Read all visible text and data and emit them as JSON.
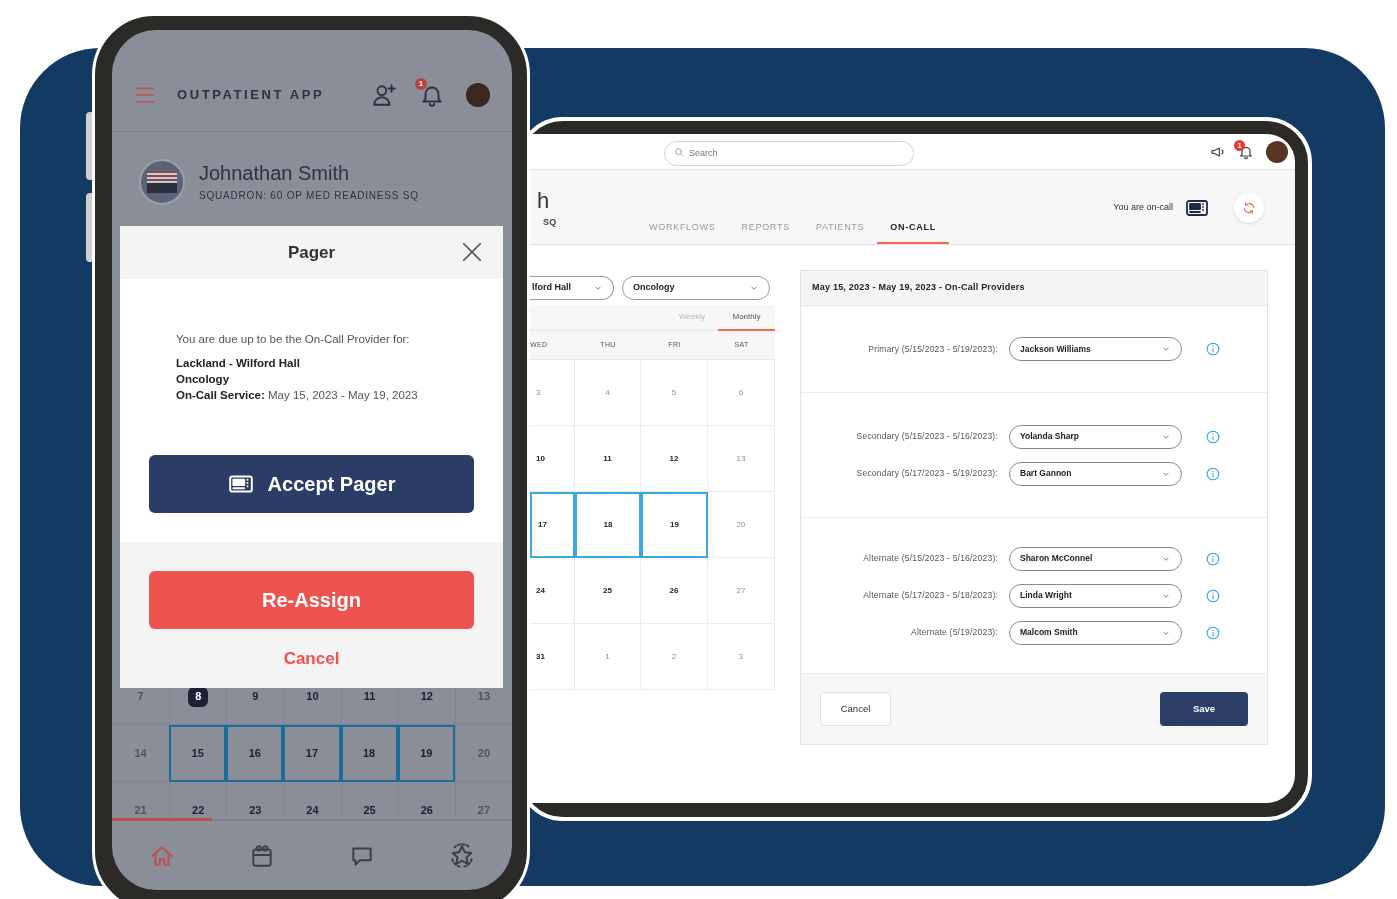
{
  "phone": {
    "app_title": "OUTPATIENT APP",
    "notification_count": "1",
    "user": {
      "name": "Johnathan Smith",
      "squadron": "SQUADRON: 60 OP MED READINESS SQ"
    },
    "modal": {
      "title": "Pager",
      "intro": "You are due up to be the On-Call Provider for:",
      "lines": [
        "**Lackland - Wilford Hall**",
        "**Oncology**",
        "**On-Call Service:** May 15, 2023 - May 19, 2023"
      ],
      "accept_button": "Accept Pager",
      "reassign_button": "Re-Assign",
      "cancel": "Cancel"
    },
    "calendar": [
      [
        {
          "day": "7",
          "muted": true,
          "today": false,
          "selected": false
        },
        {
          "day": "8",
          "muted": false,
          "today": true,
          "selected": false
        },
        {
          "day": "9",
          "muted": false,
          "today": false,
          "selected": false
        },
        {
          "day": "10",
          "muted": false,
          "today": false,
          "selected": false
        },
        {
          "day": "11",
          "muted": false,
          "today": false,
          "selected": false
        },
        {
          "day": "12",
          "muted": false,
          "today": false,
          "selected": false
        },
        {
          "day": "13",
          "muted": true,
          "today": false,
          "selected": false
        }
      ],
      [
        {
          "day": "14",
          "muted": true,
          "today": false,
          "selected": false
        },
        {
          "day": "15",
          "muted": false,
          "today": false,
          "selected": true
        },
        {
          "day": "16",
          "muted": false,
          "today": false,
          "selected": true
        },
        {
          "day": "17",
          "muted": false,
          "today": false,
          "selected": true
        },
        {
          "day": "18",
          "muted": false,
          "today": false,
          "selected": true
        },
        {
          "day": "19",
          "muted": false,
          "today": false,
          "selected": true
        },
        {
          "day": "20",
          "muted": true,
          "today": false,
          "selected": false
        }
      ],
      [
        {
          "day": "21",
          "muted": true,
          "today": false,
          "selected": false
        },
        {
          "day": "22",
          "muted": false,
          "today": false,
          "selected": false
        },
        {
          "day": "23",
          "muted": false,
          "today": false,
          "selected": false
        },
        {
          "day": "24",
          "muted": false,
          "today": false,
          "selected": false
        },
        {
          "day": "25",
          "muted": false,
          "today": false,
          "selected": false
        },
        {
          "day": "26",
          "muted": false,
          "today": false,
          "selected": false
        },
        {
          "day": "27",
          "muted": true,
          "today": false,
          "selected": false
        }
      ]
    ],
    "bottom_nav": [
      {
        "selected": true
      },
      {
        "selected": false
      },
      {
        "selected": false
      },
      {
        "selected": false
      }
    ]
  },
  "tablet": {
    "search": {
      "placeholder": "Search"
    },
    "notification_count": "1",
    "header": {
      "name_fragment": "h",
      "squadron_fragment": "SQ"
    },
    "tabs": [
      {
        "label": "WORKFLOWS",
        "selected": false
      },
      {
        "label": "REPORTS",
        "selected": false
      },
      {
        "label": "PATIENTS",
        "selected": false
      },
      {
        "label": "ON-CALL",
        "selected": true
      }
    ],
    "on_call_status": "You are on-call",
    "calendar": {
      "filters": [
        "lford Hall",
        "Oncology"
      ],
      "views": [
        {
          "label": "Weekly",
          "selected": false
        },
        {
          "label": "Monthly",
          "selected": true
        }
      ],
      "days": [
        "WED",
        "THU",
        "FRI",
        "SAT"
      ],
      "weeks": [
        [
          {
            "day": "3",
            "muted": true,
            "selected": false
          },
          {
            "day": "4",
            "muted": true,
            "selected": false
          },
          {
            "day": "5",
            "muted": true,
            "selected": false
          },
          {
            "day": "6",
            "muted": true,
            "selected": false
          }
        ],
        [
          {
            "day": "10",
            "muted": false,
            "selected": false
          },
          {
            "day": "11",
            "muted": false,
            "selected": false
          },
          {
            "day": "12",
            "muted": false,
            "selected": false
          },
          {
            "day": "13",
            "muted": true,
            "selected": false
          }
        ],
        [
          {
            "day": "17",
            "muted": false,
            "selected": true
          },
          {
            "day": "18",
            "muted": false,
            "selected": true
          },
          {
            "day": "19",
            "muted": false,
            "selected": true
          },
          {
            "day": "20",
            "muted": true,
            "selected": false
          }
        ],
        [
          {
            "day": "24",
            "muted": false,
            "selected": false
          },
          {
            "day": "25",
            "muted": false,
            "selected": false
          },
          {
            "day": "26",
            "muted": false,
            "selected": false
          },
          {
            "day": "27",
            "muted": true,
            "selected": false
          }
        ],
        [
          {
            "day": "31",
            "muted": false,
            "selected": false
          },
          {
            "day": "1",
            "muted": true,
            "selected": false
          },
          {
            "day": "2",
            "muted": true,
            "selected": false
          },
          {
            "day": "3",
            "muted": true,
            "selected": false
          }
        ]
      ]
    },
    "panel": {
      "title": "May 15, 2023 - May 19, 2023 - On-Call Providers",
      "groups": [
        [
          {
            "label": "Primary (5/15/2023 - 5/19/2023):",
            "value": "Jackson Williams"
          }
        ],
        [
          {
            "label": "Secondary (5/15/2023 - 5/16/2023):",
            "value": "Yolanda Sharp"
          },
          {
            "label": "Secondary (5/17/2023 - 5/19/2023):",
            "value": "Bart Gannon"
          }
        ],
        [
          {
            "label": "Alternate (5/15/2023 - 5/16/2023):",
            "value": "Sharon McConnel"
          },
          {
            "label": "Alternate (5/17/2023 - 5/18/2023):",
            "value": "Linda Wright"
          },
          {
            "label": "Alternate (5/19/2023):",
            "value": "Malcom Smith"
          }
        ]
      ],
      "cancel_button": "Cancel",
      "save_button": "Save"
    }
  }
}
